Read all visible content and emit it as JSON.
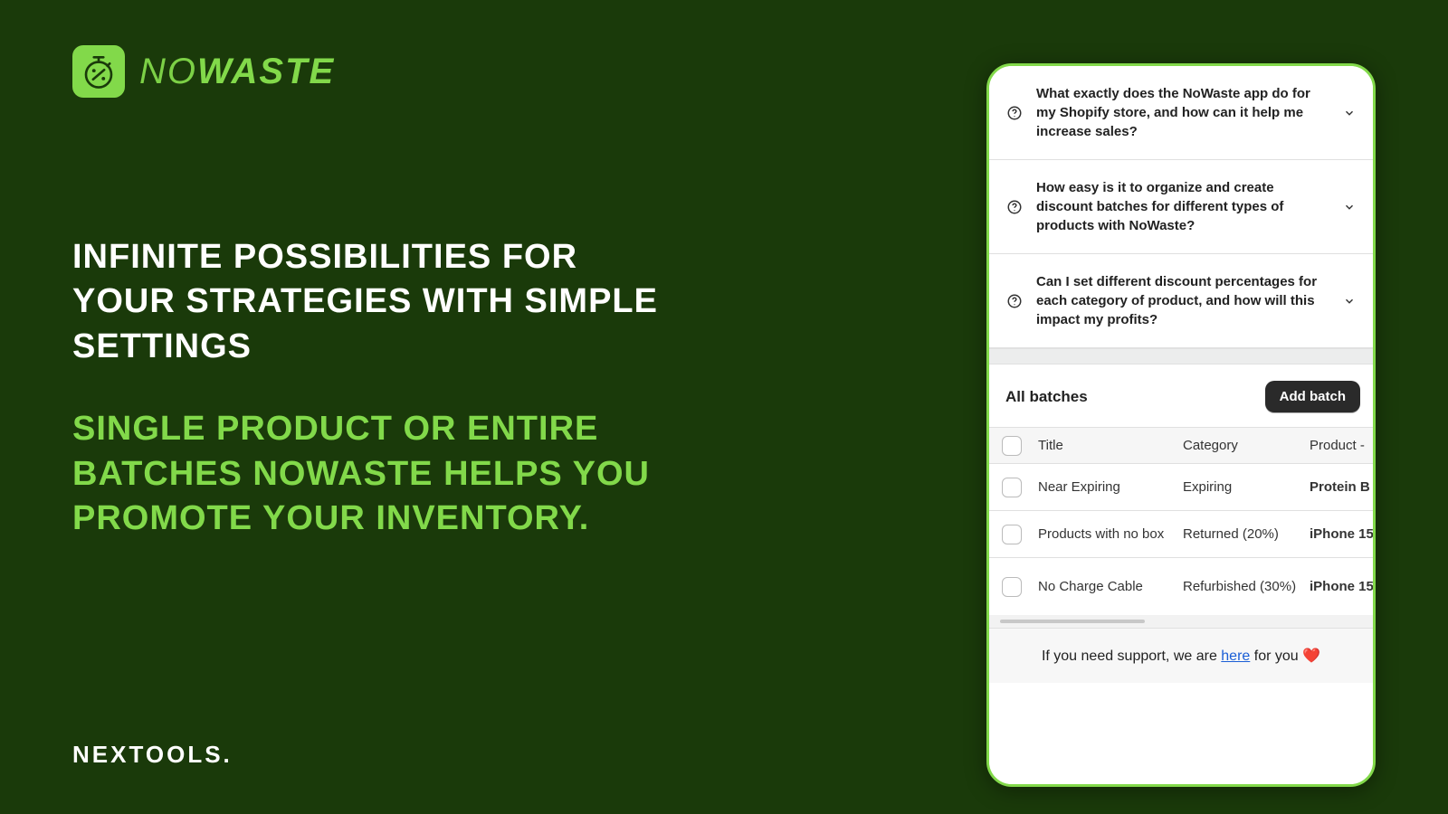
{
  "brand": {
    "logo_thin": "NO",
    "logo_bold": "WASTE",
    "footer": "NEXTOOLS."
  },
  "headings": {
    "white": "INFINITE POSSIBILITIES FOR YOUR STRATEGIES WITH SIMPLE SETTINGS",
    "green": "SINGLE PRODUCT OR ENTIRE BATCHES NOWASTE HELPS YOU PROMOTE YOUR INVENTORY."
  },
  "faq": [
    "What exactly does the NoWaste app do for my Shopify store, and how can it help me increase sales?",
    "How easy is it to organize and create discount batches for different types of products with NoWaste?",
    "Can I set different discount percentages for each category of product, and how will this impact my profits?"
  ],
  "batches": {
    "title": "All batches",
    "add_label": "Add batch",
    "columns": {
      "title": "Title",
      "category": "Category",
      "product": "Product -"
    },
    "rows": [
      {
        "title": "Near Expiring",
        "category": "Expiring",
        "product": "Protein B"
      },
      {
        "title": "Products with no box",
        "category": "Returned (20%)",
        "product": "iPhone 15"
      },
      {
        "title": "No Charge Cable",
        "category": "Refurbished (30%)",
        "product": "iPhone 15"
      }
    ]
  },
  "support": {
    "prefix": "If you need support, we are ",
    "link": "here",
    "suffix": " for you ",
    "heart": "❤️"
  }
}
